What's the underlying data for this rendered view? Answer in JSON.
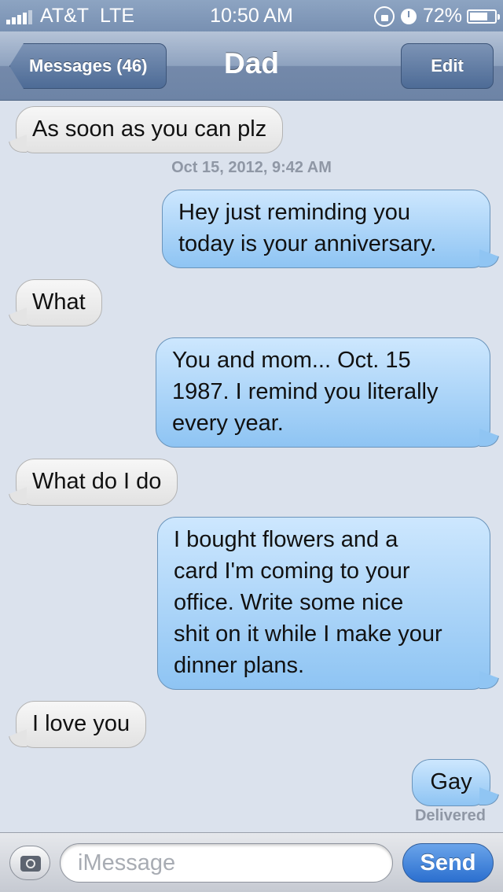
{
  "status_bar": {
    "carrier": "AT&T",
    "network": "LTE",
    "time": "10:50 AM",
    "battery": "72%",
    "battery_level": 0.72,
    "icons": [
      "signal-icon",
      "rotation-lock-icon",
      "alarm-icon",
      "battery-icon"
    ]
  },
  "nav": {
    "back_label": "Messages (46)",
    "title": "Dad",
    "edit_label": "Edit"
  },
  "conversation": {
    "messages": [
      {
        "from": "them",
        "text": "As soon as you can plz"
      },
      {
        "from": "timestamp",
        "text": "Oct 15, 2012, 9:42 AM"
      },
      {
        "from": "me",
        "lines": [
          "Hey just reminding you",
          "today is your anniversary."
        ]
      },
      {
        "from": "them",
        "text": "What"
      },
      {
        "from": "me",
        "lines": [
          "You and mom... Oct. 15",
          "1987. I remind you literally",
          "every year."
        ]
      },
      {
        "from": "them",
        "text": "What do I do"
      },
      {
        "from": "me",
        "lines": [
          "I bought flowers and a",
          "card I'm coming to your",
          "office. Write some nice",
          "shit on it while I make your",
          "dinner plans."
        ]
      },
      {
        "from": "them",
        "text": "I love you"
      },
      {
        "from": "me",
        "text": "Gay"
      }
    ],
    "delivered": "Delivered"
  },
  "input_bar": {
    "placeholder": "iMessage",
    "send_label": "Send",
    "camera_icon": "camera-icon"
  },
  "colors": {
    "background": "#dbe2ed",
    "sent_bubble": "#8ec4f3",
    "received_bubble": "#e9e9e9",
    "send_button": "#2b6fcf"
  }
}
